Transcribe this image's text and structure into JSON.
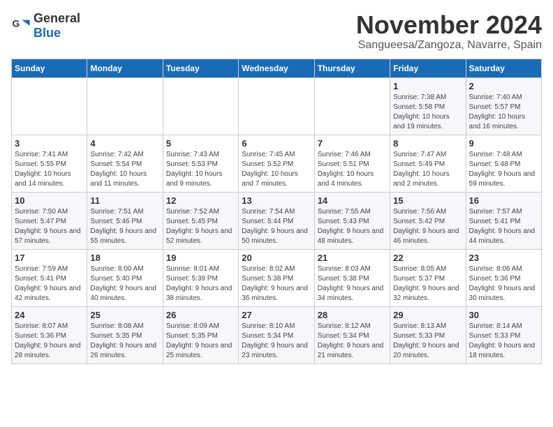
{
  "logo": {
    "text_general": "General",
    "text_blue": "Blue"
  },
  "header": {
    "month_title": "November 2024",
    "location": "Sangueesa/Zangoza, Navarre, Spain"
  },
  "days_of_week": [
    "Sunday",
    "Monday",
    "Tuesday",
    "Wednesday",
    "Thursday",
    "Friday",
    "Saturday"
  ],
  "weeks": [
    [
      {
        "day": "",
        "info": ""
      },
      {
        "day": "",
        "info": ""
      },
      {
        "day": "",
        "info": ""
      },
      {
        "day": "",
        "info": ""
      },
      {
        "day": "",
        "info": ""
      },
      {
        "day": "1",
        "info": "Sunrise: 7:38 AM\nSunset: 5:58 PM\nDaylight: 10 hours and 19 minutes."
      },
      {
        "day": "2",
        "info": "Sunrise: 7:40 AM\nSunset: 5:57 PM\nDaylight: 10 hours and 16 minutes."
      }
    ],
    [
      {
        "day": "3",
        "info": "Sunrise: 7:41 AM\nSunset: 5:55 PM\nDaylight: 10 hours and 14 minutes."
      },
      {
        "day": "4",
        "info": "Sunrise: 7:42 AM\nSunset: 5:54 PM\nDaylight: 10 hours and 11 minutes."
      },
      {
        "day": "5",
        "info": "Sunrise: 7:43 AM\nSunset: 5:53 PM\nDaylight: 10 hours and 9 minutes."
      },
      {
        "day": "6",
        "info": "Sunrise: 7:45 AM\nSunset: 5:52 PM\nDaylight: 10 hours and 7 minutes."
      },
      {
        "day": "7",
        "info": "Sunrise: 7:46 AM\nSunset: 5:51 PM\nDaylight: 10 hours and 4 minutes."
      },
      {
        "day": "8",
        "info": "Sunrise: 7:47 AM\nSunset: 5:49 PM\nDaylight: 10 hours and 2 minutes."
      },
      {
        "day": "9",
        "info": "Sunrise: 7:48 AM\nSunset: 5:48 PM\nDaylight: 9 hours and 59 minutes."
      }
    ],
    [
      {
        "day": "10",
        "info": "Sunrise: 7:50 AM\nSunset: 5:47 PM\nDaylight: 9 hours and 57 minutes."
      },
      {
        "day": "11",
        "info": "Sunrise: 7:51 AM\nSunset: 5:46 PM\nDaylight: 9 hours and 55 minutes."
      },
      {
        "day": "12",
        "info": "Sunrise: 7:52 AM\nSunset: 5:45 PM\nDaylight: 9 hours and 52 minutes."
      },
      {
        "day": "13",
        "info": "Sunrise: 7:54 AM\nSunset: 5:44 PM\nDaylight: 9 hours and 50 minutes."
      },
      {
        "day": "14",
        "info": "Sunrise: 7:55 AM\nSunset: 5:43 PM\nDaylight: 9 hours and 48 minutes."
      },
      {
        "day": "15",
        "info": "Sunrise: 7:56 AM\nSunset: 5:42 PM\nDaylight: 9 hours and 46 minutes."
      },
      {
        "day": "16",
        "info": "Sunrise: 7:57 AM\nSunset: 5:41 PM\nDaylight: 9 hours and 44 minutes."
      }
    ],
    [
      {
        "day": "17",
        "info": "Sunrise: 7:59 AM\nSunset: 5:41 PM\nDaylight: 9 hours and 42 minutes."
      },
      {
        "day": "18",
        "info": "Sunrise: 8:00 AM\nSunset: 5:40 PM\nDaylight: 9 hours and 40 minutes."
      },
      {
        "day": "19",
        "info": "Sunrise: 8:01 AM\nSunset: 5:39 PM\nDaylight: 9 hours and 38 minutes."
      },
      {
        "day": "20",
        "info": "Sunrise: 8:02 AM\nSunset: 5:38 PM\nDaylight: 9 hours and 36 minutes."
      },
      {
        "day": "21",
        "info": "Sunrise: 8:03 AM\nSunset: 5:38 PM\nDaylight: 9 hours and 34 minutes."
      },
      {
        "day": "22",
        "info": "Sunrise: 8:05 AM\nSunset: 5:37 PM\nDaylight: 9 hours and 32 minutes."
      },
      {
        "day": "23",
        "info": "Sunrise: 8:06 AM\nSunset: 5:36 PM\nDaylight: 9 hours and 30 minutes."
      }
    ],
    [
      {
        "day": "24",
        "info": "Sunrise: 8:07 AM\nSunset: 5:36 PM\nDaylight: 9 hours and 28 minutes."
      },
      {
        "day": "25",
        "info": "Sunrise: 8:08 AM\nSunset: 5:35 PM\nDaylight: 9 hours and 26 minutes."
      },
      {
        "day": "26",
        "info": "Sunrise: 8:09 AM\nSunset: 5:35 PM\nDaylight: 9 hours and 25 minutes."
      },
      {
        "day": "27",
        "info": "Sunrise: 8:10 AM\nSunset: 5:34 PM\nDaylight: 9 hours and 23 minutes."
      },
      {
        "day": "28",
        "info": "Sunrise: 8:12 AM\nSunset: 5:34 PM\nDaylight: 9 hours and 21 minutes."
      },
      {
        "day": "29",
        "info": "Sunrise: 8:13 AM\nSunset: 5:33 PM\nDaylight: 9 hours and 20 minutes."
      },
      {
        "day": "30",
        "info": "Sunrise: 8:14 AM\nSunset: 5:33 PM\nDaylight: 9 hours and 18 minutes."
      }
    ]
  ]
}
